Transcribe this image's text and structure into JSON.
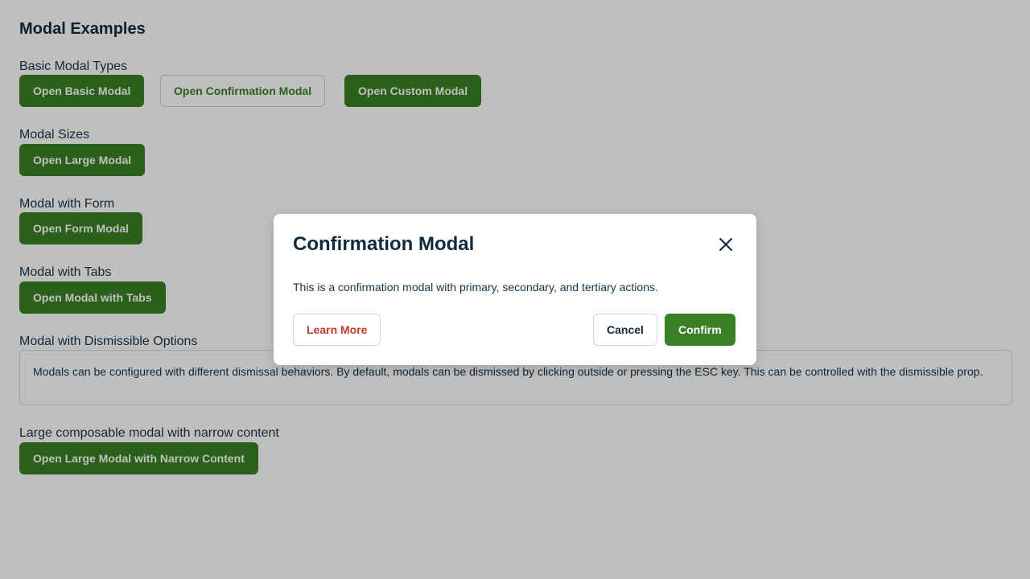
{
  "page": {
    "title": "Modal Examples"
  },
  "sections": {
    "basic": {
      "label": "Basic Modal Types",
      "buttons": [
        "Open Basic Modal",
        "Open Confirmation Modal",
        "Open Custom Modal"
      ]
    },
    "sizes": {
      "label": "Modal Sizes",
      "button": "Open Large Modal"
    },
    "form": {
      "label": "Modal with Form",
      "button": "Open Form Modal"
    },
    "tabs": {
      "label": "Modal with Tabs",
      "button": "Open Modal with Tabs"
    },
    "dismissible": {
      "label": "Modal with Dismissible Options",
      "text": "Modals can be configured with different dismissal behaviors. By default, modals can be dismissed by clicking outside or pressing the ESC key. This can be controlled with the dismissible prop."
    },
    "composable": {
      "label": "Large composable modal with narrow content",
      "button": "Open Large Modal with Narrow Content"
    }
  },
  "modal": {
    "title": "Confirmation Modal",
    "body": "This is a confirmation modal with primary, secondary, and tertiary actions.",
    "tertiary_label": "Learn More",
    "cancel_label": "Cancel",
    "confirm_label": "Confirm",
    "close_icon": "close-icon"
  },
  "colors": {
    "primary": "#3a8024",
    "tertiary": "#c0392b",
    "text": "#0d2b3e"
  }
}
